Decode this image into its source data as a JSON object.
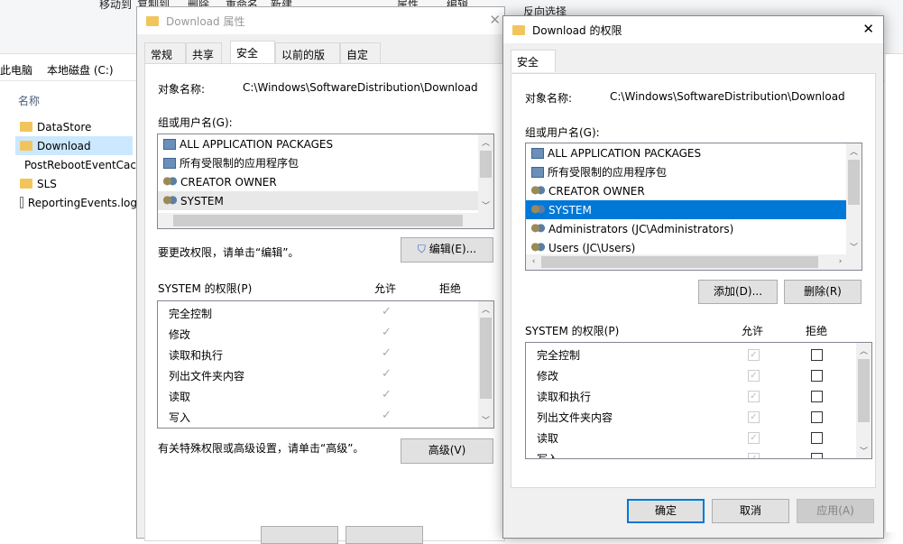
{
  "explorer": {
    "ribbon": [
      "移动到",
      "复制到",
      "删除",
      "重命名",
      "新建",
      "属性",
      "编辑",
      "反向选择"
    ],
    "breadcrumb": [
      "此电脑",
      "本地磁盘 (C:)"
    ],
    "column_name": "名称",
    "files": [
      {
        "name": "DataStore",
        "type": "folder"
      },
      {
        "name": "Download",
        "type": "folder"
      },
      {
        "name": "PostRebootEventCache",
        "type": "folder"
      },
      {
        "name": "SLS",
        "type": "folder"
      },
      {
        "name": "ReportingEvents.log",
        "type": "file"
      }
    ]
  },
  "props": {
    "title": "Download 属性",
    "tabs": [
      "常规",
      "共享",
      "安全",
      "以前的版本",
      "自定义"
    ],
    "active_tab": "安全",
    "object_label": "对象名称:",
    "object_value": "C:\\Windows\\SoftwareDistribution\\Download",
    "group_label": "组或用户名(G):",
    "users": [
      "ALL APPLICATION PACKAGES",
      "所有受限制的应用程序包",
      "CREATOR OWNER",
      "SYSTEM"
    ],
    "edit_hint": "要更改权限，请单击“编辑”。",
    "edit_button": "编辑(E)...",
    "perm_title": "SYSTEM 的权限(P)",
    "allow": "允许",
    "deny": "拒绝",
    "perms": [
      "完全控制",
      "修改",
      "读取和执行",
      "列出文件夹内容",
      "读取",
      "写入"
    ],
    "adv_hint": "有关特殊权限或高级设置，请单击“高级”。",
    "adv_button": "高级(V)"
  },
  "perm_dlg": {
    "title": "Download 的权限",
    "tab": "安全",
    "object_label": "对象名称:",
    "object_value": "C:\\Windows\\SoftwareDistribution\\Download",
    "group_label": "组或用户名(G):",
    "users": [
      "ALL APPLICATION PACKAGES",
      "所有受限制的应用程序包",
      "CREATOR OWNER",
      "SYSTEM",
      "Administrators (JC\\Administrators)",
      "Users (JC\\Users)"
    ],
    "selected_user": "SYSTEM",
    "add_button": "添加(D)...",
    "remove_button": "删除(R)",
    "perm_title": "SYSTEM 的权限(P)",
    "allow": "允许",
    "deny": "拒绝",
    "perms": [
      "完全控制",
      "修改",
      "读取和执行",
      "列出文件夹内容",
      "读取",
      "写入"
    ],
    "ok": "确定",
    "cancel": "取消",
    "apply": "应用(A)",
    "accent": "#0078d7"
  }
}
